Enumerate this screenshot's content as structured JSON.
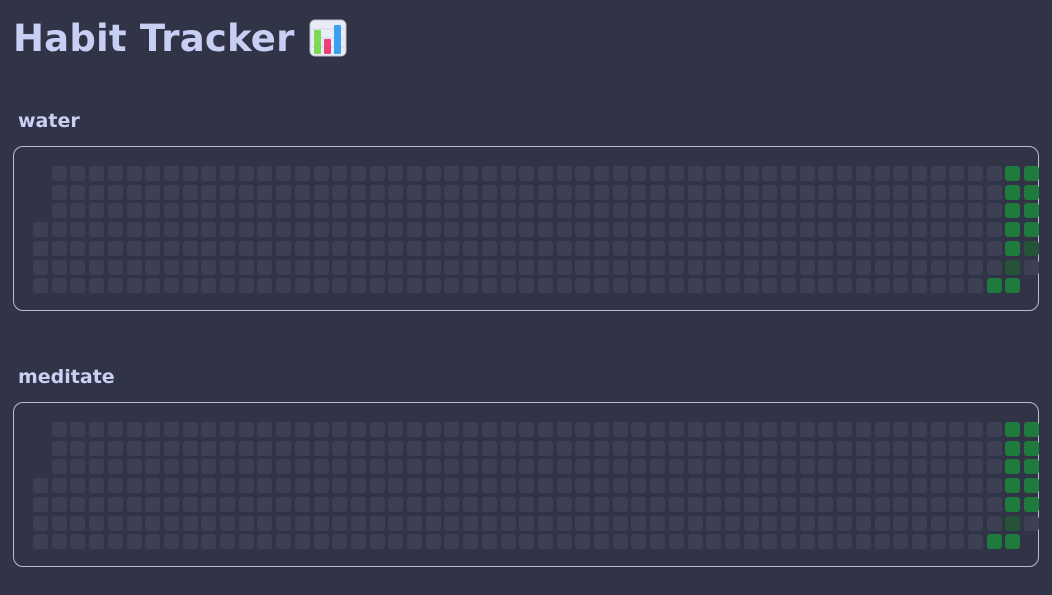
{
  "page": {
    "title": "Habit Tracker",
    "title_icon": "bar-chart-icon"
  },
  "colors": {
    "background": "#313346",
    "empty_cell": "#3d4052",
    "done_cell": "#1f7a3d",
    "done_cell_faded": "#27523a",
    "card_border": "#b8bccd"
  },
  "heatmap": {
    "weeks": 53,
    "days_per_week": 7,
    "first_week_start_day": 3,
    "last_week_end_day": 5
  },
  "habits": [
    {
      "name": "water",
      "completed": [
        {
          "week": 51,
          "day": 6
        },
        {
          "week": 52,
          "day": 6
        },
        {
          "week": 52,
          "day": 0
        },
        {
          "week": 53,
          "day": 0
        },
        {
          "week": 52,
          "day": 1
        },
        {
          "week": 53,
          "day": 1
        },
        {
          "week": 52,
          "day": 2
        },
        {
          "week": 53,
          "day": 2
        },
        {
          "week": 52,
          "day": 3
        },
        {
          "week": 53,
          "day": 3
        },
        {
          "week": 52,
          "day": 4
        },
        {
          "week": 53,
          "day": 4,
          "faded": true
        },
        {
          "week": 52,
          "day": 5,
          "faded": true
        }
      ]
    },
    {
      "name": "meditate",
      "completed": [
        {
          "week": 51,
          "day": 6
        },
        {
          "week": 52,
          "day": 6
        },
        {
          "week": 52,
          "day": 0
        },
        {
          "week": 53,
          "day": 0
        },
        {
          "week": 52,
          "day": 1
        },
        {
          "week": 53,
          "day": 1
        },
        {
          "week": 52,
          "day": 2
        },
        {
          "week": 53,
          "day": 2
        },
        {
          "week": 52,
          "day": 3
        },
        {
          "week": 53,
          "day": 3
        },
        {
          "week": 52,
          "day": 4
        },
        {
          "week": 53,
          "day": 4
        },
        {
          "week": 52,
          "day": 5,
          "faded": true
        }
      ]
    }
  ]
}
